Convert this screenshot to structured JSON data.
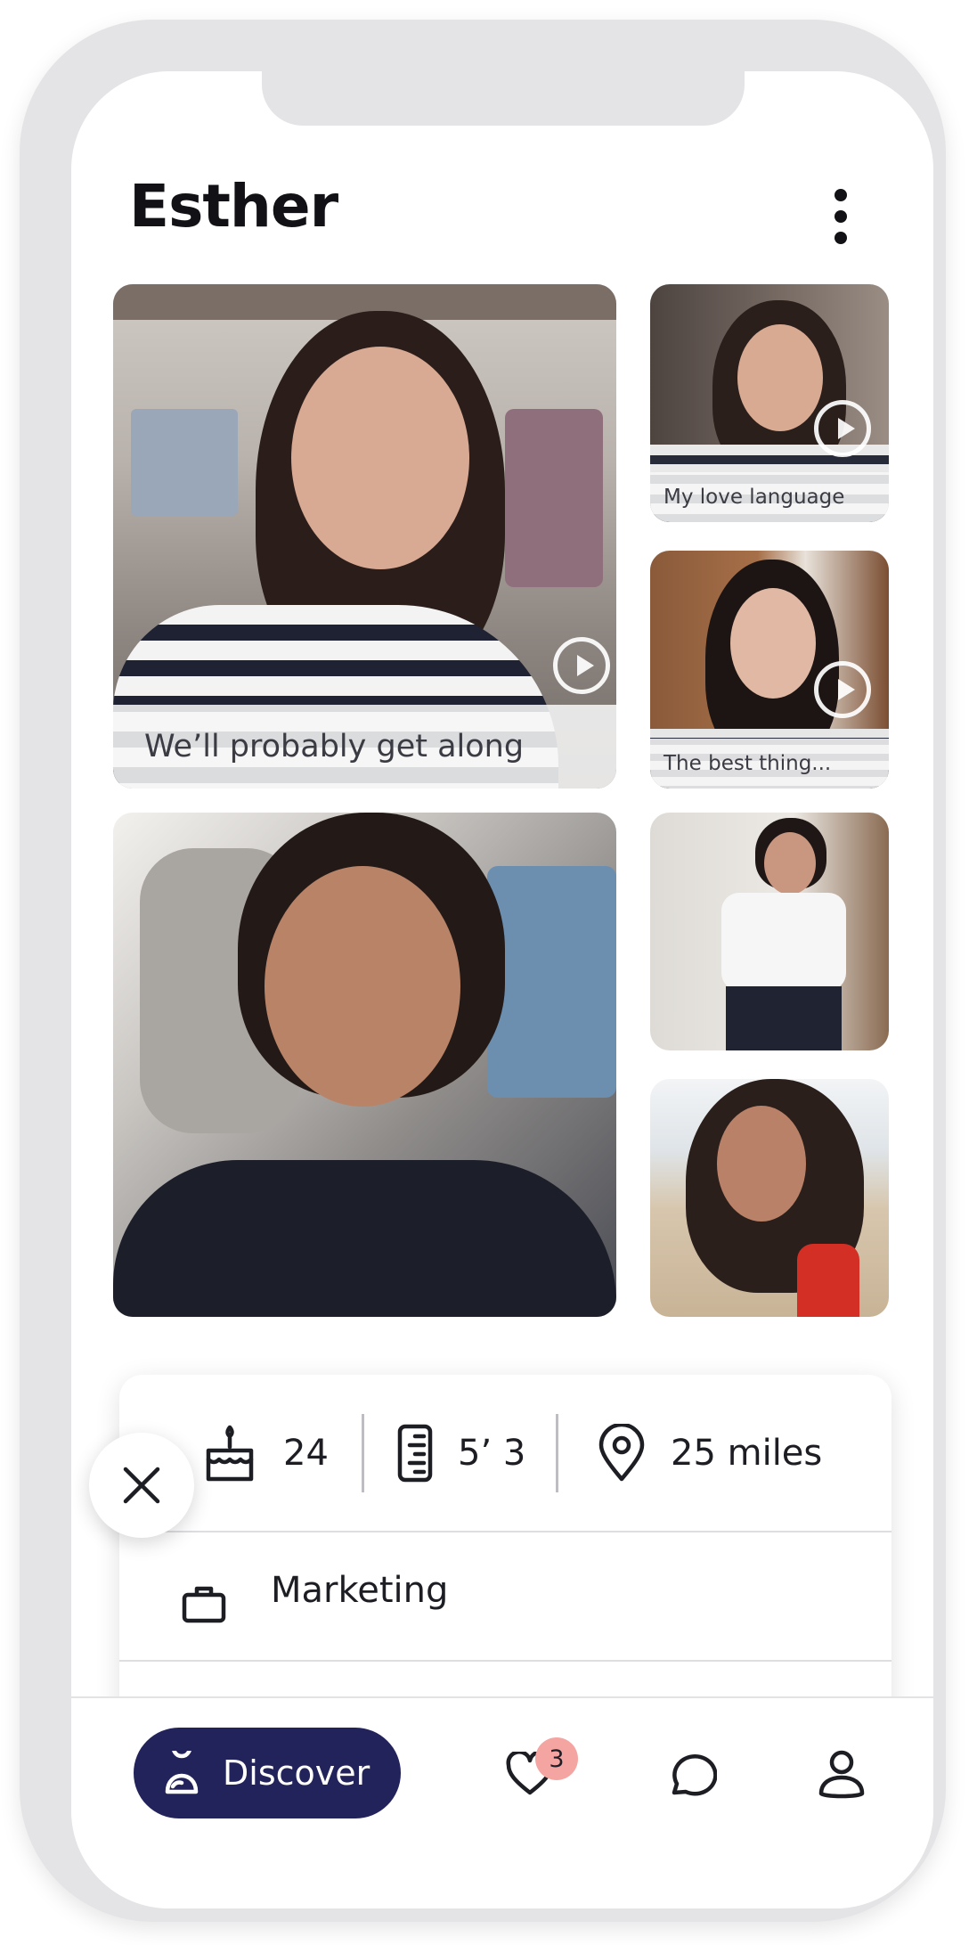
{
  "profile": {
    "name": "Esther"
  },
  "media": {
    "main_prompt": "We’ll probably get along",
    "prompt_love_language": "My love language",
    "prompt_best_thing": "The best thing..."
  },
  "stats": {
    "age": "24",
    "height": "5’ 3",
    "distance": "25 miles"
  },
  "job": {
    "title": "Marketing"
  },
  "nav": {
    "discover_label": "Discover",
    "likes_badge": "3"
  },
  "colors": {
    "accent": "#23235c",
    "badge": "#f4a5a1",
    "frame": "#e4e4e6"
  },
  "icons": [
    "more-vertical-icon",
    "play-icon",
    "cake-icon",
    "ruler-icon",
    "location-pin-icon",
    "briefcase-icon",
    "close-icon",
    "discover-icon",
    "heart-icon",
    "chat-bubble-icon",
    "profile-icon"
  ]
}
